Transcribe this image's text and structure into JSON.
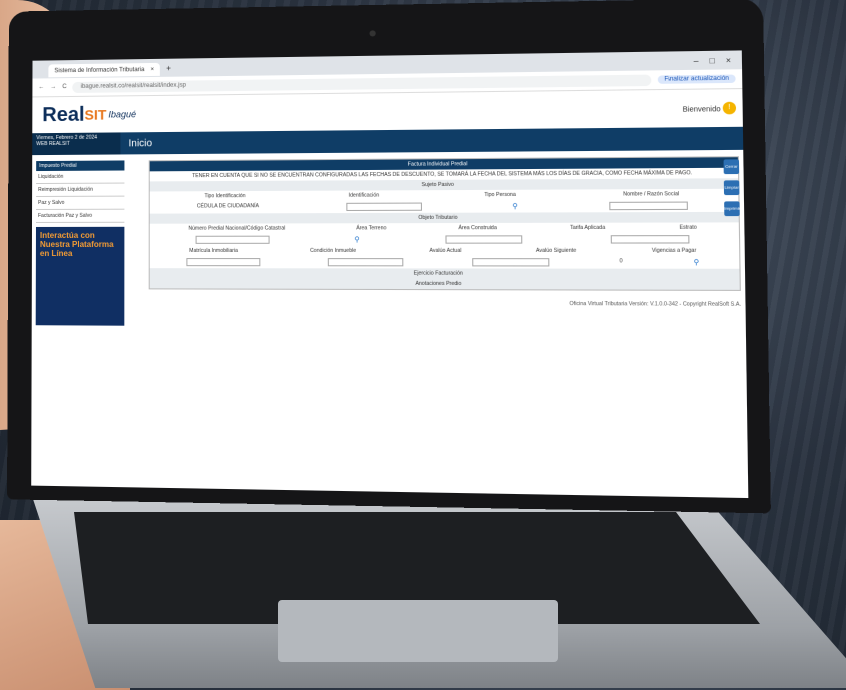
{
  "browser": {
    "tab_title": "Sistema de Información Tributaria",
    "tab_close": "×",
    "new_tab": "+",
    "url": "ibague.realsit.co/realsit/realsit/index.jsp",
    "update_button": "Finalizar actualización",
    "back": "←",
    "forward": "→",
    "reload": "C",
    "minimize": "–",
    "maximize": "□",
    "close": "×"
  },
  "site": {
    "logo_real": "Real",
    "logo_sit": "SIT",
    "logo_city": "Ibagué",
    "welcome": "Bienvenido",
    "date": "Viernes, Febrero 2 de 2024",
    "version": "WEB REALSIT",
    "page_title": "Inicio"
  },
  "sidebar": {
    "heading": "Impuesto Predial",
    "items": [
      "Liquidación",
      "Reimpresión Liquidación",
      "Paz y Salvo",
      "Facturación Paz y Salvo"
    ],
    "promo_title_1": "Interactúa con",
    "promo_title_2": "Nuestra Plataforma",
    "promo_title_3": "en Línea"
  },
  "form": {
    "title": "Factura Individual Predial",
    "notice": "TENER EN CUENTA QUE SI NO SE ENCUENTRAN CONFIGURADAS LAS FECHAS DE DESCUENTO, SE TOMARÁ LA FECHA DEL SISTEMA MÁS LOS DÍAS DE GRACIA, COMO FECHA MÁXIMA DE PAGO.",
    "section_payer": "Sujeto Pasivo",
    "tipo_persona": "Tipo Persona",
    "tipo_identificacion": "Tipo Identificación",
    "identificacion": "Identificación",
    "nombre": "Nombre / Razón Social",
    "tipo_id_value": "CÉDULA DE CIUDADANÍA",
    "section_object": "Objeto Tributario",
    "numero_predio": "Número Predial Nacional/Código Catastral",
    "area_terreno": "Área Terreno",
    "area_construida": "Área Construida",
    "tarifa": "Tarifa Aplicada",
    "estrato": "Estrato",
    "matricula": "Matrícula Inmobiliaria",
    "condicion": "Condición Inmueble",
    "avaluo_actual": "Avalúo Actual",
    "avaluo_siguiente": "Avalúo Siguiente",
    "vigencias": "Vigencias a Pagar",
    "vigencias_value": "0",
    "section_ejercicio": "Ejercicio Facturación",
    "section_anotaciones": "Anotaciones Predio"
  },
  "footer": "Oficina Virtual Tributaria Versión: V.1.0.0-342 - Copyright RealSoft S.A.",
  "side_buttons": [
    "Cerrar",
    "Limpiar",
    "Imprimir"
  ]
}
